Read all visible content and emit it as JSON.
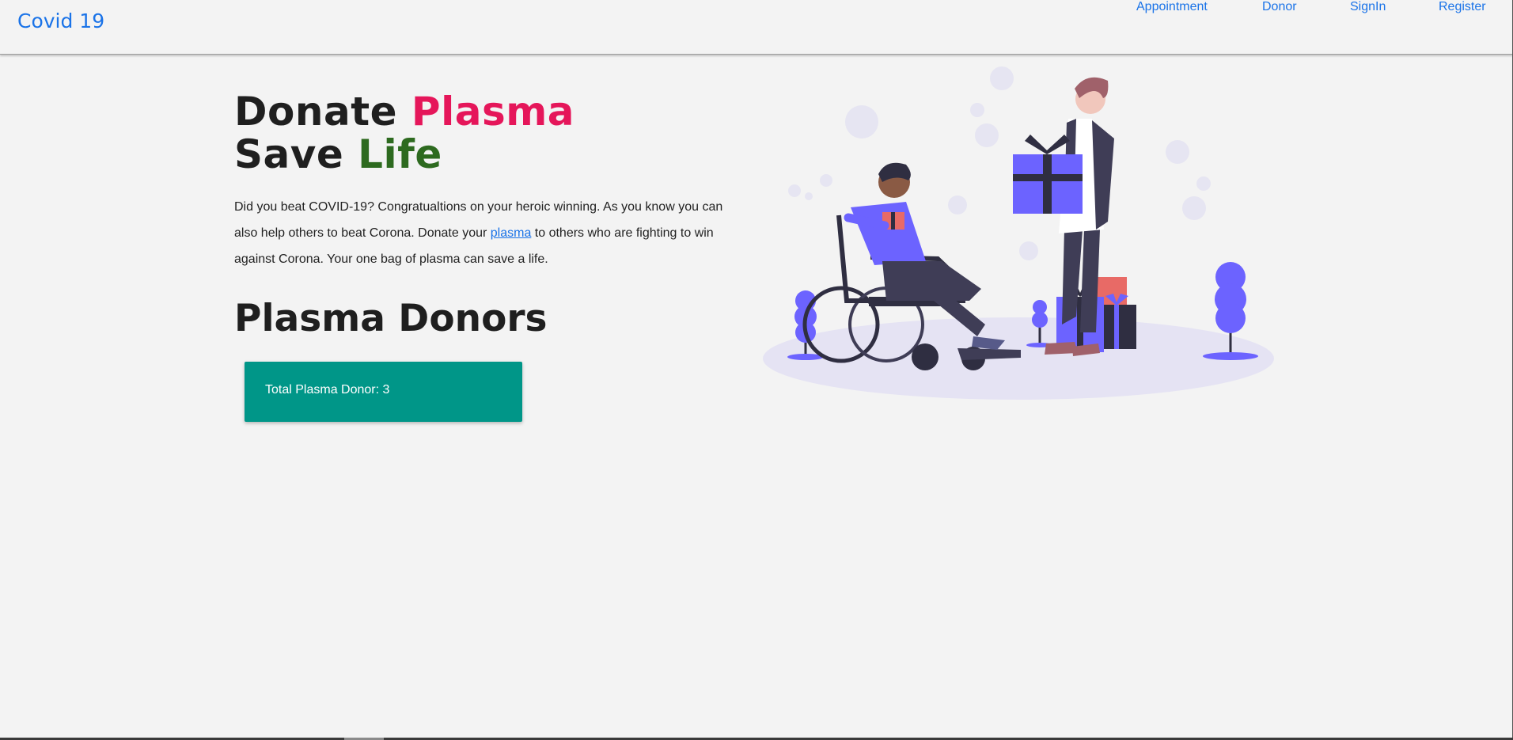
{
  "navbar": {
    "brand": "Covid 19",
    "links": [
      "Appointment",
      "Donor",
      "SignIn",
      "Register"
    ]
  },
  "hero": {
    "line1_prefix": "Donate ",
    "line1_accent": "Plasma",
    "line2_prefix": "Save ",
    "line2_accent": "Life"
  },
  "intro": {
    "text_before": "Did you beat COVID-19? Congratualtions on your heroic winning. As you know you can also help others to beat Corona. Donate your ",
    "link_text": "plasma",
    "text_after": " to others who are fighting to win against Corona. Your one bag of plasma can save a life."
  },
  "donors": {
    "heading": "Plasma Donors",
    "card_label": "Total Plasma Donor: 3"
  },
  "colors": {
    "brand_blue": "#1a73e8",
    "plasma_red": "#e5165a",
    "life_green": "#2d6a1f",
    "card_teal": "#009688",
    "illustration_purple": "#6c63ff"
  }
}
